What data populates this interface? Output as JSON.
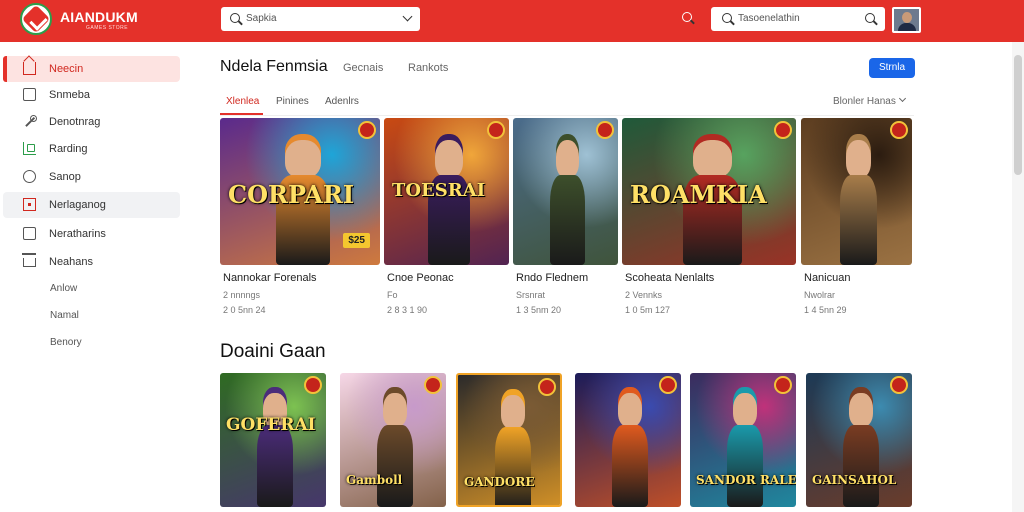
{
  "app": {
    "brand": "AIANDUKM",
    "brand_sub": "GAMES STORE",
    "search_placeholder": "Sapkia",
    "search2_placeholder": "Tasoenelathin"
  },
  "sidebar": {
    "items": [
      {
        "label": "Neecin",
        "icon": "home-icon",
        "state": "active"
      },
      {
        "label": "Snmeba",
        "icon": "square-icon"
      },
      {
        "label": "Denotnrag",
        "icon": "wand-icon"
      },
      {
        "label": "Rarding",
        "icon": "chart-icon"
      },
      {
        "label": "Sanop",
        "icon": "circle-icon"
      },
      {
        "label": "Nerlaganog",
        "icon": "red-square-icon",
        "state": "hover"
      },
      {
        "label": "Neratharins",
        "icon": "list-icon"
      },
      {
        "label": "Neahans",
        "icon": "house-icon"
      },
      {
        "label": "Anlow",
        "icon": ""
      },
      {
        "label": "Namal",
        "icon": ""
      },
      {
        "label": "Benory",
        "icon": ""
      }
    ]
  },
  "main": {
    "title": "Ndela Fenmsia",
    "top_tabs": [
      "Gecnais",
      "Rankots"
    ],
    "action_button": "Strnla",
    "sub_tabs": [
      "Xlenlea",
      "Pinines",
      "Adenlrs"
    ],
    "sort_label": "Blonler Hanas"
  },
  "featured": [
    {
      "title": "Nannokar Forenals",
      "meta1": "2 nnnngs",
      "meta2": "2 0 5nn 24",
      "logo": "CORPARI",
      "price": "$25",
      "colors": [
        "#5a2a8c",
        "#1ea5d8",
        "#e68a2e"
      ]
    },
    {
      "title": "Cnoe Peonac",
      "meta1": "Fo",
      "meta2": "2 8 3 1 90",
      "logo": "TOESRAI",
      "price": "",
      "colors": [
        "#c94a12",
        "#f0a63a",
        "#3a1c5e"
      ]
    },
    {
      "title": "Rndo Flednem",
      "meta1": "Srsnrat",
      "meta2": "1 3 5nm 20",
      "logo": "",
      "price": "",
      "colors": [
        "#4b6c8c",
        "#9fc1d4",
        "#3d4f2b"
      ]
    },
    {
      "title": "Scoheata Nenlalts",
      "meta1": "2 Vennks",
      "meta2": "1 0 5m 127",
      "logo": "ROAMKIA",
      "price": "",
      "colors": [
        "#1f5a3a",
        "#57a35f",
        "#b22a22"
      ]
    },
    {
      "title": "Nanicuan",
      "meta1": "Nwolrar",
      "meta2": "1 4 5nn 29",
      "logo": "",
      "price": "",
      "colors": [
        "#5c3d20",
        "#2b1c10",
        "#a87d4a"
      ]
    }
  ],
  "section_title": "Doaini Gaan",
  "grid": [
    {
      "logo": "GOFERAI",
      "colors": [
        "#2f6b22",
        "#7dc251",
        "#4b2c7a"
      ]
    },
    {
      "logo": "Gamboll",
      "colors": [
        "#f6d7e7",
        "#c79aca",
        "#6c4a2a"
      ]
    },
    {
      "logo": "GANDORE",
      "colors": [
        "#2b2a2a",
        "#7b5b35",
        "#f0a326"
      ]
    },
    {
      "logo": "",
      "colors": [
        "#1b1c5a",
        "#3a4bb0",
        "#e05a1e"
      ]
    },
    {
      "logo": "SANDOR RALEK",
      "colors": [
        "#3b2b5e",
        "#c0327a",
        "#1a9aab"
      ]
    },
    {
      "logo": "GAINSAHOL",
      "colors": [
        "#1c3a56",
        "#3c8bb0",
        "#7a3c22"
      ]
    }
  ]
}
